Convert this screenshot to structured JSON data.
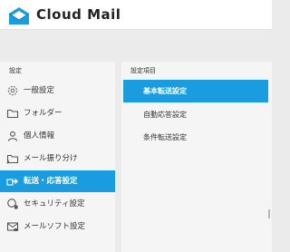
{
  "app": {
    "title": "Cloud Mail"
  },
  "sidebar": {
    "heading": "設定",
    "items": [
      {
        "label": "一般設定",
        "icon": "gear-icon"
      },
      {
        "label": "フォルダー",
        "icon": "folder-icon"
      },
      {
        "label": "個人情報",
        "icon": "person-icon"
      },
      {
        "label": "メール振り分け",
        "icon": "folder-sort-icon"
      },
      {
        "label": "転送・応答設定",
        "icon": "forward-icon",
        "active": true
      },
      {
        "label": "セキュリティ設定",
        "icon": "shield-icon"
      },
      {
        "label": "メールソフト設定",
        "icon": "mail-software-icon"
      }
    ]
  },
  "settings_panel": {
    "heading": "設定項目",
    "items": [
      {
        "label": "基本転送設定",
        "active": true
      },
      {
        "label": "自動応答設定"
      },
      {
        "label": "条件転送設定"
      }
    ]
  },
  "colors": {
    "accent": "#1a9de0",
    "background": "#ebebeb",
    "panel": "#f5f5f5"
  }
}
